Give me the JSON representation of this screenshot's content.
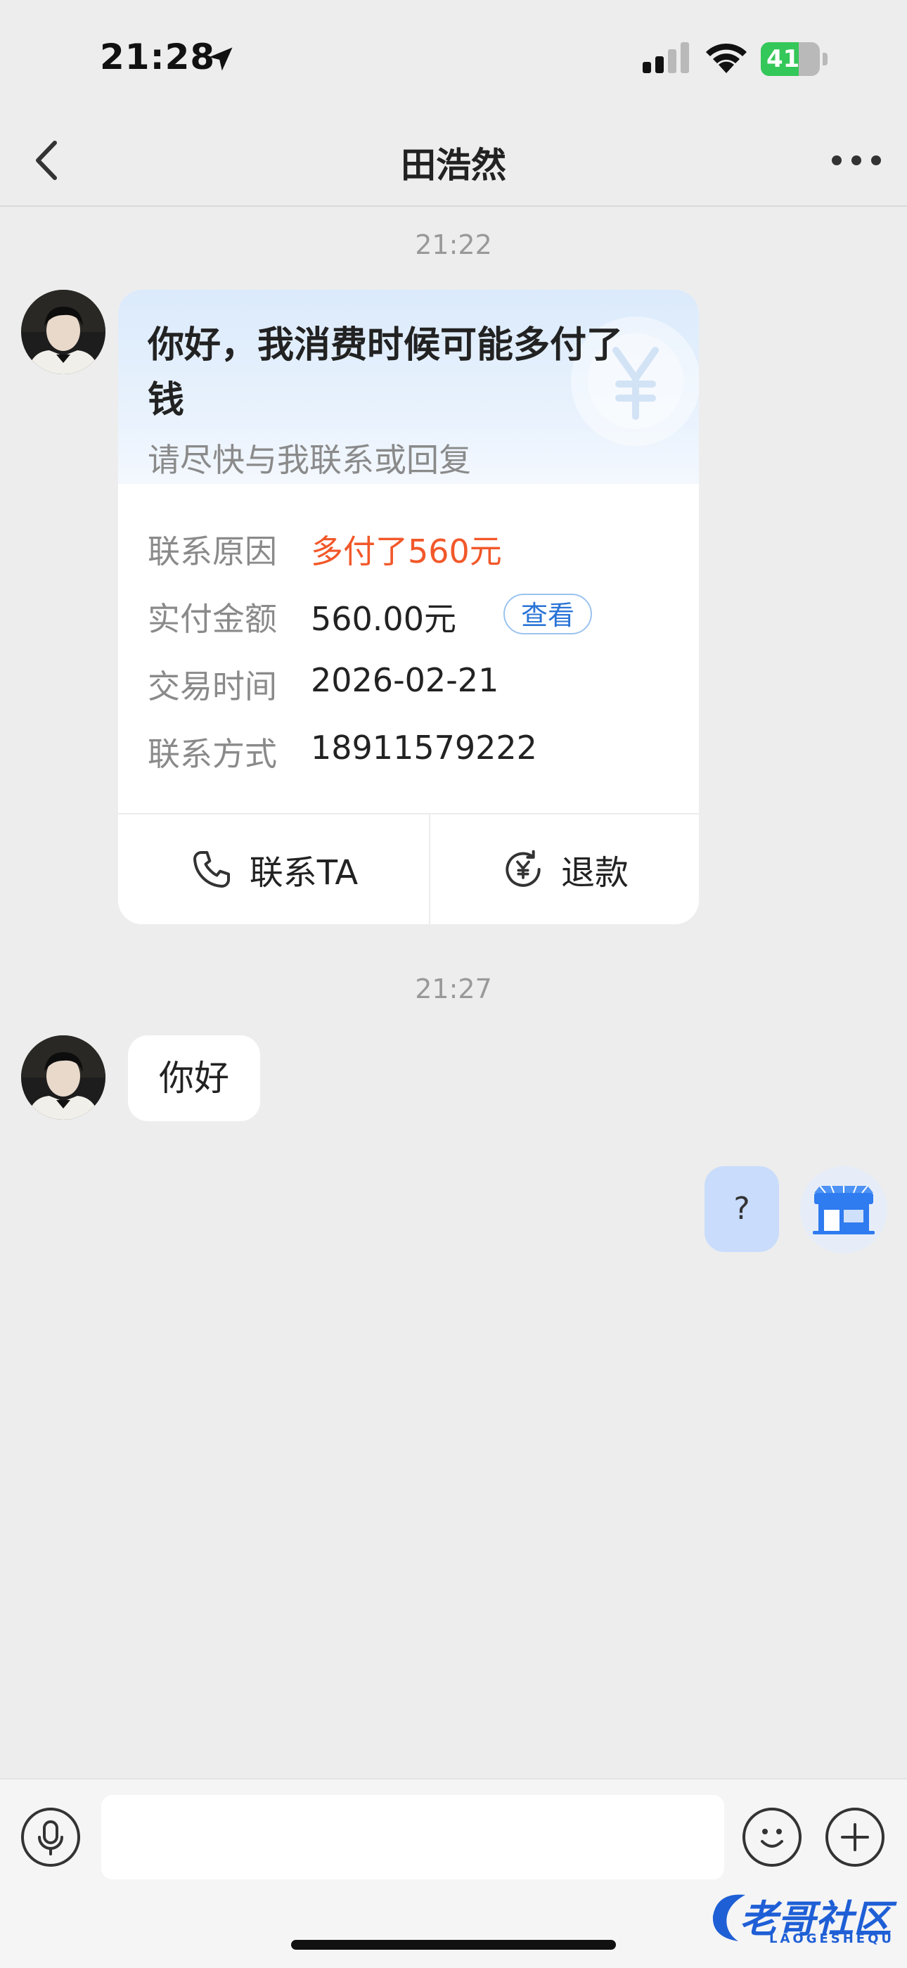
{
  "status_bar": {
    "time": "21:28",
    "battery": "41",
    "battery_level": 0.41,
    "icons": [
      "location-arrow-icon",
      "cellular-signal-icon",
      "wifi-icon",
      "battery-charging-icon"
    ]
  },
  "nav": {
    "title": "田浩然",
    "back_icon": "chevron-left-icon",
    "more_icon": "more-dots-icon"
  },
  "messages": {
    "timestamp1": "21:22",
    "card": {
      "title": "你好，我消费时候可能多付了钱",
      "subtitle": "请尽快与我联系或回复",
      "rows": [
        {
          "label": "联系原因",
          "value": "多付了560元"
        },
        {
          "label": "实付金额",
          "value": "560.00元"
        },
        {
          "label": "交易时间",
          "value": "2026-02-21"
        },
        {
          "label": "联系方式",
          "value": "18911579222"
        }
      ],
      "view_button": "查看",
      "contact_button": "联系TA",
      "refund_button": "退款",
      "accent_color": "#f2582a",
      "link_color": "#2a74d6"
    },
    "timestamp2": "21:27",
    "incoming_text": "你好",
    "outgoing_text": "?"
  },
  "input_bar": {
    "voice_icon": "microphone-icon",
    "emoji_icon": "smiley-icon",
    "plus_icon": "plus-icon",
    "placeholder": ""
  },
  "watermark": {
    "text": "老哥社区",
    "sub": "LAOGESHEQU"
  }
}
